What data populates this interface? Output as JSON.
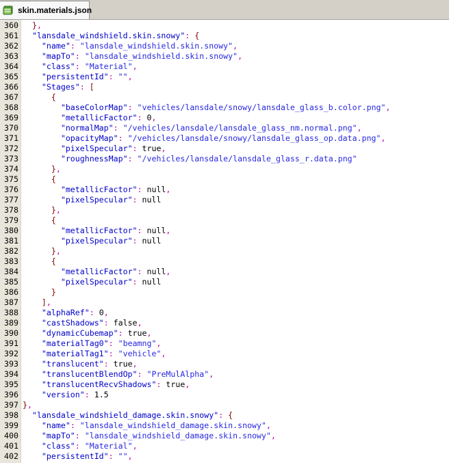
{
  "tab": {
    "label": "skin.materials.json",
    "icon": "notepad-file-icon"
  },
  "colors": {
    "key": "#0000c8",
    "string": "#2828e0",
    "punct": "#c000a0",
    "brace": "#800000",
    "gutter": "#e8e6da"
  },
  "lines": [
    {
      "n": "360",
      "text": "  },"
    },
    {
      "n": "361",
      "text": "  \"lansdale_windshield.skin.snowy\": {"
    },
    {
      "n": "362",
      "text": "    \"name\": \"lansdale_windshield.skin.snowy\","
    },
    {
      "n": "363",
      "text": "    \"mapTo\": \"lansdale_windshield.skin.snowy\","
    },
    {
      "n": "364",
      "text": "    \"class\": \"Material\","
    },
    {
      "n": "365",
      "text": "    \"persistentId\": \"\","
    },
    {
      "n": "366",
      "text": "    \"Stages\": ["
    },
    {
      "n": "367",
      "text": "      {"
    },
    {
      "n": "368",
      "text": "        \"baseColorMap\": \"vehicles/lansdale/snowy/lansdale_glass_b.color.png\","
    },
    {
      "n": "369",
      "text": "        \"metallicFactor\": 0,"
    },
    {
      "n": "370",
      "text": "        \"normalMap\": \"/vehicles/lansdale/lansdale_glass_nm.normal.png\","
    },
    {
      "n": "371",
      "text": "        \"opacityMap\": \"/vehicles/lansdale/snowy/lansdale_glass_op.data.png\","
    },
    {
      "n": "372",
      "text": "        \"pixelSpecular\": true,"
    },
    {
      "n": "373",
      "text": "        \"roughnessMap\": \"/vehicles/lansdale/lansdale_glass_r.data.png\""
    },
    {
      "n": "374",
      "text": "      },"
    },
    {
      "n": "375",
      "text": "      {"
    },
    {
      "n": "376",
      "text": "        \"metallicFactor\": null,"
    },
    {
      "n": "377",
      "text": "        \"pixelSpecular\": null"
    },
    {
      "n": "378",
      "text": "      },"
    },
    {
      "n": "379",
      "text": "      {"
    },
    {
      "n": "380",
      "text": "        \"metallicFactor\": null,"
    },
    {
      "n": "381",
      "text": "        \"pixelSpecular\": null"
    },
    {
      "n": "382",
      "text": "      },"
    },
    {
      "n": "383",
      "text": "      {"
    },
    {
      "n": "384",
      "text": "        \"metallicFactor\": null,"
    },
    {
      "n": "385",
      "text": "        \"pixelSpecular\": null"
    },
    {
      "n": "386",
      "text": "      }"
    },
    {
      "n": "387",
      "text": "    ],"
    },
    {
      "n": "388",
      "text": "    \"alphaRef\": 0,"
    },
    {
      "n": "389",
      "text": "    \"castShadows\": false,"
    },
    {
      "n": "390",
      "text": "    \"dynamicCubemap\": true,"
    },
    {
      "n": "391",
      "text": "    \"materialTag0\": \"beamng\","
    },
    {
      "n": "392",
      "text": "    \"materialTag1\": \"vehicle\","
    },
    {
      "n": "393",
      "text": "    \"translucent\": true,"
    },
    {
      "n": "394",
      "text": "    \"translucentBlendOp\": \"PreMulAlpha\","
    },
    {
      "n": "395",
      "text": "    \"translucentRecvShadows\": true,"
    },
    {
      "n": "396",
      "text": "    \"version\": 1.5"
    },
    {
      "n": "397",
      "text": "},"
    },
    {
      "n": "398",
      "text": "  \"lansdale_windshield_damage.skin.snowy\": {"
    },
    {
      "n": "399",
      "text": "    \"name\": \"lansdale_windshield_damage.skin.snowy\","
    },
    {
      "n": "400",
      "text": "    \"mapTo\": \"lansdale_windshield_damage.skin.snowy\","
    },
    {
      "n": "401",
      "text": "    \"class\": \"Material\","
    },
    {
      "n": "402",
      "text": "    \"persistentId\": \"\","
    }
  ]
}
